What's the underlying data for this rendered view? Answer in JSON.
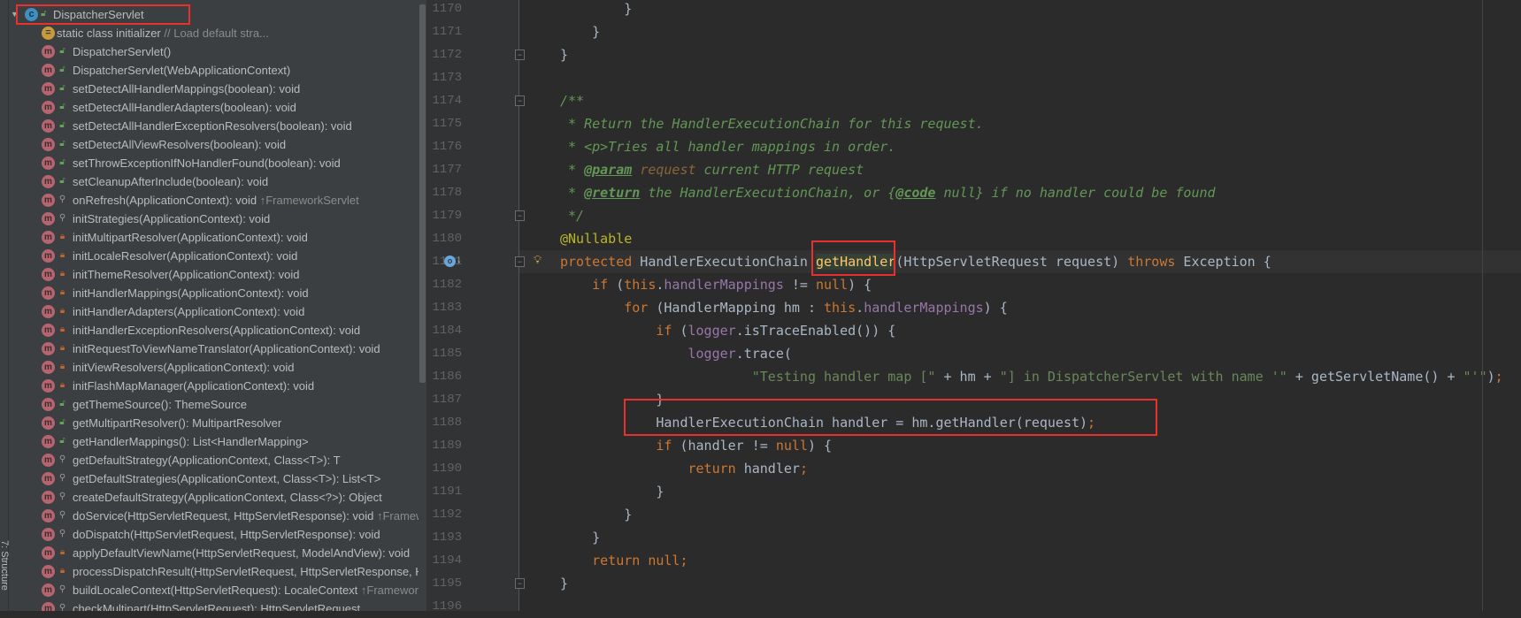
{
  "tool_strip": {
    "label": "7: Structure"
  },
  "structure": {
    "root": {
      "label": "DispatcherServlet",
      "icon": "class-icon",
      "visibility": "public"
    },
    "items": [
      {
        "kind": "static",
        "label": "static class initializer",
        "suffix": " // Load default stra..."
      },
      {
        "kind": "method",
        "visibility": "public",
        "label": "DispatcherServlet()",
        "suffix": ""
      },
      {
        "kind": "method",
        "visibility": "public",
        "label": "DispatcherServlet(WebApplicationContext)",
        "suffix": ""
      },
      {
        "kind": "method",
        "visibility": "public",
        "label": "setDetectAllHandlerMappings(boolean): void",
        "suffix": ""
      },
      {
        "kind": "method",
        "visibility": "public",
        "label": "setDetectAllHandlerAdapters(boolean): void",
        "suffix": ""
      },
      {
        "kind": "method",
        "visibility": "public",
        "label": "setDetectAllHandlerExceptionResolvers(boolean): void",
        "suffix": ""
      },
      {
        "kind": "method",
        "visibility": "public",
        "label": "setDetectAllViewResolvers(boolean): void",
        "suffix": ""
      },
      {
        "kind": "method",
        "visibility": "public",
        "label": "setThrowExceptionIfNoHandlerFound(boolean): void",
        "suffix": ""
      },
      {
        "kind": "method",
        "visibility": "public",
        "label": "setCleanupAfterInclude(boolean): void",
        "suffix": ""
      },
      {
        "kind": "method",
        "visibility": "protected",
        "label": "onRefresh(ApplicationContext): void",
        "suffix": " ↑FrameworkServlet"
      },
      {
        "kind": "method",
        "visibility": "protected",
        "label": "initStrategies(ApplicationContext): void",
        "suffix": ""
      },
      {
        "kind": "method",
        "visibility": "private",
        "label": "initMultipartResolver(ApplicationContext): void",
        "suffix": ""
      },
      {
        "kind": "method",
        "visibility": "private",
        "label": "initLocaleResolver(ApplicationContext): void",
        "suffix": ""
      },
      {
        "kind": "method",
        "visibility": "private",
        "label": "initThemeResolver(ApplicationContext): void",
        "suffix": ""
      },
      {
        "kind": "method",
        "visibility": "private",
        "label": "initHandlerMappings(ApplicationContext): void",
        "suffix": ""
      },
      {
        "kind": "method",
        "visibility": "private",
        "label": "initHandlerAdapters(ApplicationContext): void",
        "suffix": ""
      },
      {
        "kind": "method",
        "visibility": "private",
        "label": "initHandlerExceptionResolvers(ApplicationContext): void",
        "suffix": ""
      },
      {
        "kind": "method",
        "visibility": "private",
        "label": "initRequestToViewNameTranslator(ApplicationContext): void",
        "suffix": ""
      },
      {
        "kind": "method",
        "visibility": "private",
        "label": "initViewResolvers(ApplicationContext): void",
        "suffix": ""
      },
      {
        "kind": "method",
        "visibility": "private",
        "label": "initFlashMapManager(ApplicationContext): void",
        "suffix": ""
      },
      {
        "kind": "method",
        "visibility": "public",
        "label": "getThemeSource(): ThemeSource",
        "suffix": ""
      },
      {
        "kind": "method",
        "visibility": "public",
        "label": "getMultipartResolver(): MultipartResolver",
        "suffix": ""
      },
      {
        "kind": "method",
        "visibility": "public",
        "label": "getHandlerMappings(): List<HandlerMapping>",
        "suffix": ""
      },
      {
        "kind": "method",
        "visibility": "protected",
        "label": "getDefaultStrategy(ApplicationContext, Class<T>): T",
        "suffix": ""
      },
      {
        "kind": "method",
        "visibility": "protected",
        "label": "getDefaultStrategies(ApplicationContext, Class<T>): List<T>",
        "suffix": ""
      },
      {
        "kind": "method",
        "visibility": "protected",
        "label": "createDefaultStrategy(ApplicationContext, Class<?>): Object",
        "suffix": ""
      },
      {
        "kind": "method",
        "visibility": "protected",
        "label": "doService(HttpServletRequest, HttpServletResponse): void",
        "suffix": " ↑FrameworkServlet"
      },
      {
        "kind": "method",
        "visibility": "protected",
        "label": "doDispatch(HttpServletRequest, HttpServletResponse): void",
        "suffix": ""
      },
      {
        "kind": "method",
        "visibility": "private",
        "label": "applyDefaultViewName(HttpServletRequest, ModelAndView): void",
        "suffix": ""
      },
      {
        "kind": "method",
        "visibility": "private",
        "label": "processDispatchResult(HttpServletRequest, HttpServletResponse, HandlerExecutionChain, ModelAndView, Exception): void",
        "suffix": ""
      },
      {
        "kind": "method",
        "visibility": "protected",
        "label": "buildLocaleContext(HttpServletRequest): LocaleContext",
        "suffix": " ↑FrameworkServlet"
      },
      {
        "kind": "method",
        "visibility": "protected",
        "label": "checkMultipart(HttpServletRequest): HttpServletRequest",
        "suffix": ""
      }
    ]
  },
  "editor": {
    "current_line": 1181,
    "fold_lines": [
      1172,
      1174,
      1179,
      1181,
      1195
    ],
    "colors": {
      "keyword": "#cc7832",
      "comment": "#629755",
      "field": "#9876aa",
      "string": "#6a8759",
      "annotation": "#bbb529",
      "highlight_box": "#e8312f"
    },
    "lines": [
      {
        "n": "1170",
        "tokens": [
          [
            "        }",
            "plain"
          ]
        ]
      },
      {
        "n": "1171",
        "tokens": [
          [
            "    }",
            "plain"
          ]
        ]
      },
      {
        "n": "1172",
        "tokens": [
          [
            "}",
            "plain"
          ]
        ]
      },
      {
        "n": "1173",
        "tokens": []
      },
      {
        "n": "1174",
        "tokens": [
          [
            "/**",
            "comment"
          ]
        ]
      },
      {
        "n": "1175",
        "tokens": [
          [
            " * Return the HandlerExecutionChain for this request.",
            "comment"
          ]
        ]
      },
      {
        "n": "1176",
        "tokens": [
          [
            " * <p>Tries all handler mappings in order.",
            "comment"
          ]
        ]
      },
      {
        "n": "1177",
        "tokens": [
          [
            " * ",
            "comment"
          ],
          [
            "@param",
            "doctag"
          ],
          [
            " ",
            "comment"
          ],
          [
            "request",
            "docparam"
          ],
          [
            " current HTTP request",
            "comment"
          ]
        ]
      },
      {
        "n": "1178",
        "tokens": [
          [
            " * ",
            "comment"
          ],
          [
            "@return",
            "doctag"
          ],
          [
            " the HandlerExecutionChain, or {",
            "comment"
          ],
          [
            "@code",
            "doctag"
          ],
          [
            " null} if no handler could be found",
            "comment"
          ]
        ]
      },
      {
        "n": "1179",
        "tokens": [
          [
            " */",
            "comment"
          ]
        ]
      },
      {
        "n": "1180",
        "tokens": [
          [
            "@Nullable",
            "annotation"
          ]
        ]
      },
      {
        "n": "1181",
        "tokens": [
          [
            "protected",
            "keyword"
          ],
          [
            " HandlerExecutionChain ",
            "plain"
          ],
          [
            "getHandler",
            "method-decl"
          ],
          [
            "(HttpServletRequest request) ",
            "plain"
          ],
          [
            "throws",
            "keyword"
          ],
          [
            " Exception {",
            "plain"
          ]
        ]
      },
      {
        "n": "1182",
        "tokens": [
          [
            "    ",
            "plain"
          ],
          [
            "if",
            "keyword"
          ],
          [
            " (",
            "plain"
          ],
          [
            "this",
            "keyword"
          ],
          [
            ".",
            "plain"
          ],
          [
            "handlerMappings",
            "field"
          ],
          [
            " != ",
            "plain"
          ],
          [
            "null",
            "keyword"
          ],
          [
            ") {",
            "plain"
          ]
        ]
      },
      {
        "n": "1183",
        "tokens": [
          [
            "        ",
            "plain"
          ],
          [
            "for",
            "keyword"
          ],
          [
            " (HandlerMapping hm : ",
            "plain"
          ],
          [
            "this",
            "keyword"
          ],
          [
            ".",
            "plain"
          ],
          [
            "handlerMappings",
            "field"
          ],
          [
            ") {",
            "plain"
          ]
        ]
      },
      {
        "n": "1184",
        "tokens": [
          [
            "            ",
            "plain"
          ],
          [
            "if",
            "keyword"
          ],
          [
            " (",
            "plain"
          ],
          [
            "logger",
            "field"
          ],
          [
            ".isTraceEnabled()) {",
            "plain"
          ]
        ]
      },
      {
        "n": "1185",
        "tokens": [
          [
            "                ",
            "plain"
          ],
          [
            "logger",
            "field"
          ],
          [
            ".trace(",
            "plain"
          ]
        ]
      },
      {
        "n": "1186",
        "tokens": [
          [
            "                        ",
            "plain"
          ],
          [
            "\"Testing handler map [\"",
            "string"
          ],
          [
            " + hm + ",
            "plain"
          ],
          [
            "\"] in DispatcherServlet with name '\"",
            "string"
          ],
          [
            " + getServletName() + ",
            "plain"
          ],
          [
            "\"'\"",
            "string"
          ],
          [
            ")",
            "plain"
          ],
          [
            ";",
            "keyword"
          ]
        ]
      },
      {
        "n": "1187",
        "tokens": [
          [
            "            }",
            "plain"
          ]
        ]
      },
      {
        "n": "1188",
        "tokens": [
          [
            "            HandlerExecutionChain handler = hm.getHandler(request)",
            "plain"
          ],
          [
            ";",
            "keyword"
          ]
        ]
      },
      {
        "n": "1189",
        "tokens": [
          [
            "            ",
            "plain"
          ],
          [
            "if",
            "keyword"
          ],
          [
            " (handler != ",
            "plain"
          ],
          [
            "null",
            "keyword"
          ],
          [
            ") {",
            "plain"
          ]
        ]
      },
      {
        "n": "1190",
        "tokens": [
          [
            "                ",
            "plain"
          ],
          [
            "return",
            "keyword"
          ],
          [
            " handler",
            "plain"
          ],
          [
            ";",
            "keyword"
          ]
        ]
      },
      {
        "n": "1191",
        "tokens": [
          [
            "            }",
            "plain"
          ]
        ]
      },
      {
        "n": "1192",
        "tokens": [
          [
            "        }",
            "plain"
          ]
        ]
      },
      {
        "n": "1193",
        "tokens": [
          [
            "    }",
            "plain"
          ]
        ]
      },
      {
        "n": "1194",
        "tokens": [
          [
            "    ",
            "plain"
          ],
          [
            "return null;",
            "keyword"
          ]
        ]
      },
      {
        "n": "1195",
        "tokens": [
          [
            "}",
            "plain"
          ]
        ]
      },
      {
        "n": "1196",
        "tokens": []
      }
    ]
  }
}
